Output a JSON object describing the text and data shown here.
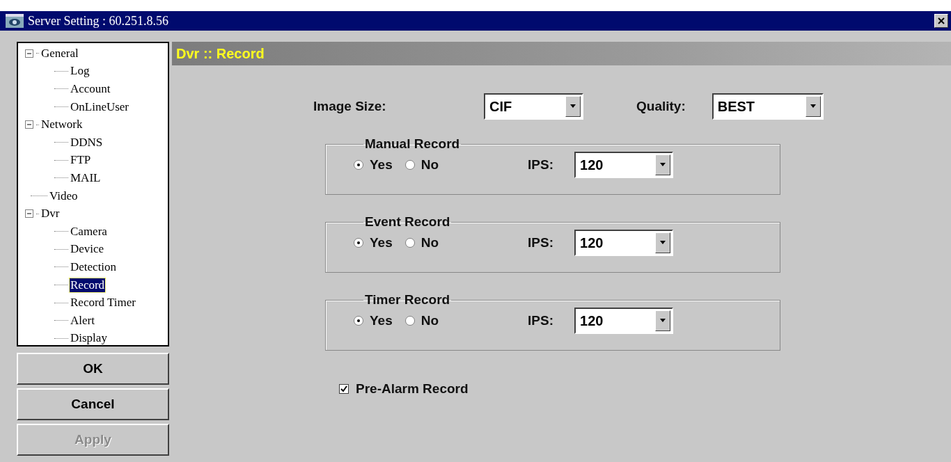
{
  "window": {
    "title": "Server Setting : 60.251.8.56"
  },
  "tree": [
    {
      "label": "General",
      "expanded": true,
      "selected": false,
      "children": [
        {
          "label": "Log",
          "selected": false
        },
        {
          "label": "Account",
          "selected": false
        },
        {
          "label": "OnLineUser",
          "selected": false
        }
      ]
    },
    {
      "label": "Network",
      "expanded": true,
      "selected": false,
      "children": [
        {
          "label": "DDNS",
          "selected": false
        },
        {
          "label": "FTP",
          "selected": false
        },
        {
          "label": "MAIL",
          "selected": false
        }
      ]
    },
    {
      "label": "Video",
      "selected": false
    },
    {
      "label": "Dvr",
      "expanded": true,
      "selected": false,
      "children": [
        {
          "label": "Camera",
          "selected": false
        },
        {
          "label": "Device",
          "selected": false
        },
        {
          "label": "Detection",
          "selected": false
        },
        {
          "label": "Record",
          "selected": true
        },
        {
          "label": "Record Timer",
          "selected": false
        },
        {
          "label": "Alert",
          "selected": false
        },
        {
          "label": "Display",
          "selected": false
        }
      ]
    }
  ],
  "buttons": [
    {
      "label": "OK",
      "disabled": false
    },
    {
      "label": "Cancel",
      "disabled": false
    },
    {
      "label": "Apply",
      "disabled": true
    }
  ],
  "header": "Dvr :: Record",
  "image_size": {
    "label": "Image Size:",
    "value": "CIF"
  },
  "quality": {
    "label": "Quality:",
    "value": "BEST"
  },
  "groups": [
    {
      "title": "Manual Record",
      "options": [
        {
          "label": "Yes",
          "selected": true
        },
        {
          "label": "No",
          "selected": false
        }
      ],
      "ips_label": "IPS:",
      "ips": "120"
    },
    {
      "title": "Event Record",
      "options": [
        {
          "label": "Yes",
          "selected": true
        },
        {
          "label": "No",
          "selected": false
        }
      ],
      "ips_label": "IPS:",
      "ips": "120"
    },
    {
      "title": "Timer Record",
      "options": [
        {
          "label": "Yes",
          "selected": true
        },
        {
          "label": "No",
          "selected": false
        }
      ],
      "ips_label": "IPS:",
      "ips": "120"
    }
  ],
  "pre_alarm": {
    "label": "Pre-Alarm Record",
    "checked": true
  }
}
